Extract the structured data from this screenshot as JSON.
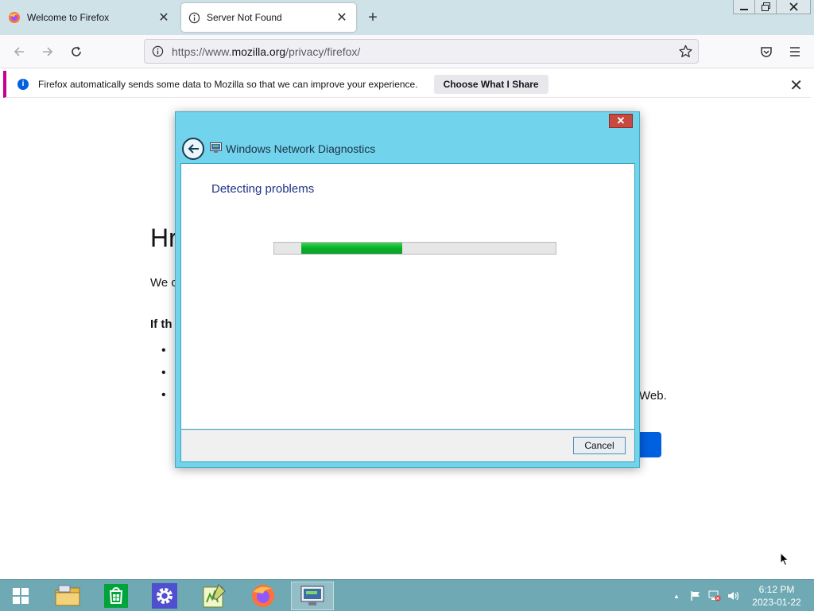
{
  "browser": {
    "tabs": [
      {
        "title": "Welcome to Firefox",
        "active": false
      },
      {
        "title": "Server Not Found",
        "active": true
      }
    ],
    "new_tab_label": "+",
    "url": {
      "prefix": "https://www.",
      "domain": "mozilla.org",
      "path": "/privacy/firefox/"
    }
  },
  "notification": {
    "text": "Firefox automatically sends some data to Mozilla so that we can improve your experience.",
    "button": "Choose What I Share",
    "close": "✕"
  },
  "error_page": {
    "title_visible_start": "Hr",
    "title_visible_end": ".",
    "desc_visible_start": "We c",
    "sub_visible_start": "If th",
    "bullet_glyph": "•",
    "line_end": "Web."
  },
  "dialog": {
    "title": "Windows Network Diagnostics",
    "heading": "Detecting problems",
    "progress": 0.36,
    "cancel": "Cancel",
    "close": "✕"
  },
  "taskbar": {
    "time": "6:12 PM",
    "date": "2023-01-22",
    "tray_caret": "▲"
  },
  "colors": {
    "dialog_frame": "#71d4ec",
    "progress_green": "#06b025",
    "taskbar": "#6fa9b4",
    "notification_accent": "#c70090"
  }
}
